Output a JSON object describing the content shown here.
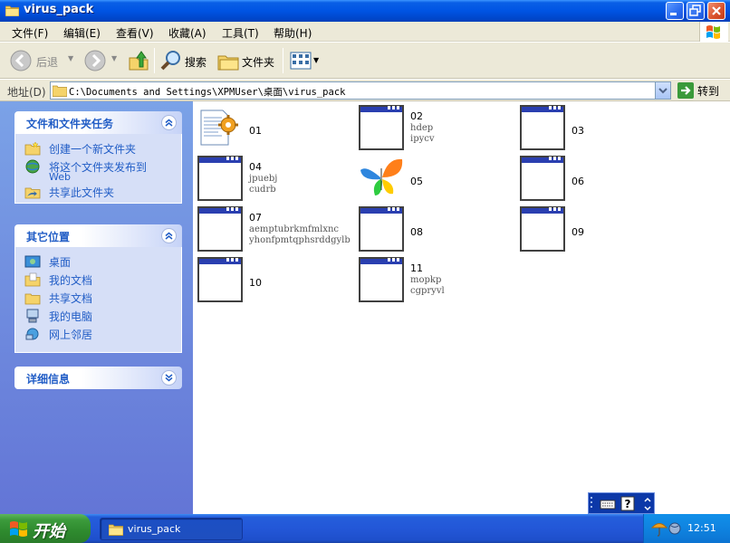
{
  "window": {
    "title": "virus_pack"
  },
  "menu": [
    {
      "label": "文件(F)"
    },
    {
      "label": "编辑(E)"
    },
    {
      "label": "查看(V)"
    },
    {
      "label": "收藏(A)"
    },
    {
      "label": "工具(T)"
    },
    {
      "label": "帮助(H)"
    }
  ],
  "toolbar": {
    "back_label": "后退",
    "search_label": "搜索",
    "folders_label": "文件夹"
  },
  "address": {
    "label": "地址(D)",
    "value": "C:\\Documents and Settings\\XPMUser\\桌面\\virus_pack",
    "go_label": "转到"
  },
  "panels": {
    "tasks": {
      "title": "文件和文件夹任务",
      "items": [
        {
          "label": "创建一个新文件夹"
        },
        {
          "label": "将这个文件夹发布到",
          "label2": "Web"
        },
        {
          "label": "共享此文件夹"
        }
      ]
    },
    "other": {
      "title": "其它位置",
      "items": [
        {
          "label": "桌面"
        },
        {
          "label": "我的文档"
        },
        {
          "label": "共享文档"
        },
        {
          "label": "我的电脑"
        },
        {
          "label": "网上邻居"
        }
      ]
    },
    "details": {
      "title": "详细信息"
    }
  },
  "files": [
    {
      "name": "01",
      "icon": "settings-file-icon"
    },
    {
      "name": "02",
      "line2": "hdep",
      "line3": "ipycv",
      "icon": "application-icon"
    },
    {
      "name": "03",
      "icon": "application-icon"
    },
    {
      "name": "04",
      "line2": "jpuebj",
      "line3": "cudrb",
      "icon": "application-icon"
    },
    {
      "name": "05",
      "icon": "msn-butterfly-icon"
    },
    {
      "name": "06",
      "icon": "application-icon"
    },
    {
      "name": "07",
      "line2": "aemptubrkmfmlxnc",
      "line3": "yhonfpmtqphsrddgylb",
      "icon": "application-icon"
    },
    {
      "name": "08",
      "icon": "application-icon"
    },
    {
      "name": "09",
      "icon": "application-icon"
    },
    {
      "name": "10",
      "icon": "application-icon"
    },
    {
      "name": "11",
      "line2": "mopkp",
      "line3": "cgpryvl",
      "icon": "application-icon"
    }
  ],
  "taskbar": {
    "start_label": "开始",
    "window_label": "virus_pack",
    "clock": "12:51"
  },
  "colors": {
    "titlebar": "#0054e3",
    "sidebar": "#7ba2e7",
    "panel_title": "#215dc6",
    "taskbar": "#245edb",
    "start": "#3c9b3c"
  }
}
